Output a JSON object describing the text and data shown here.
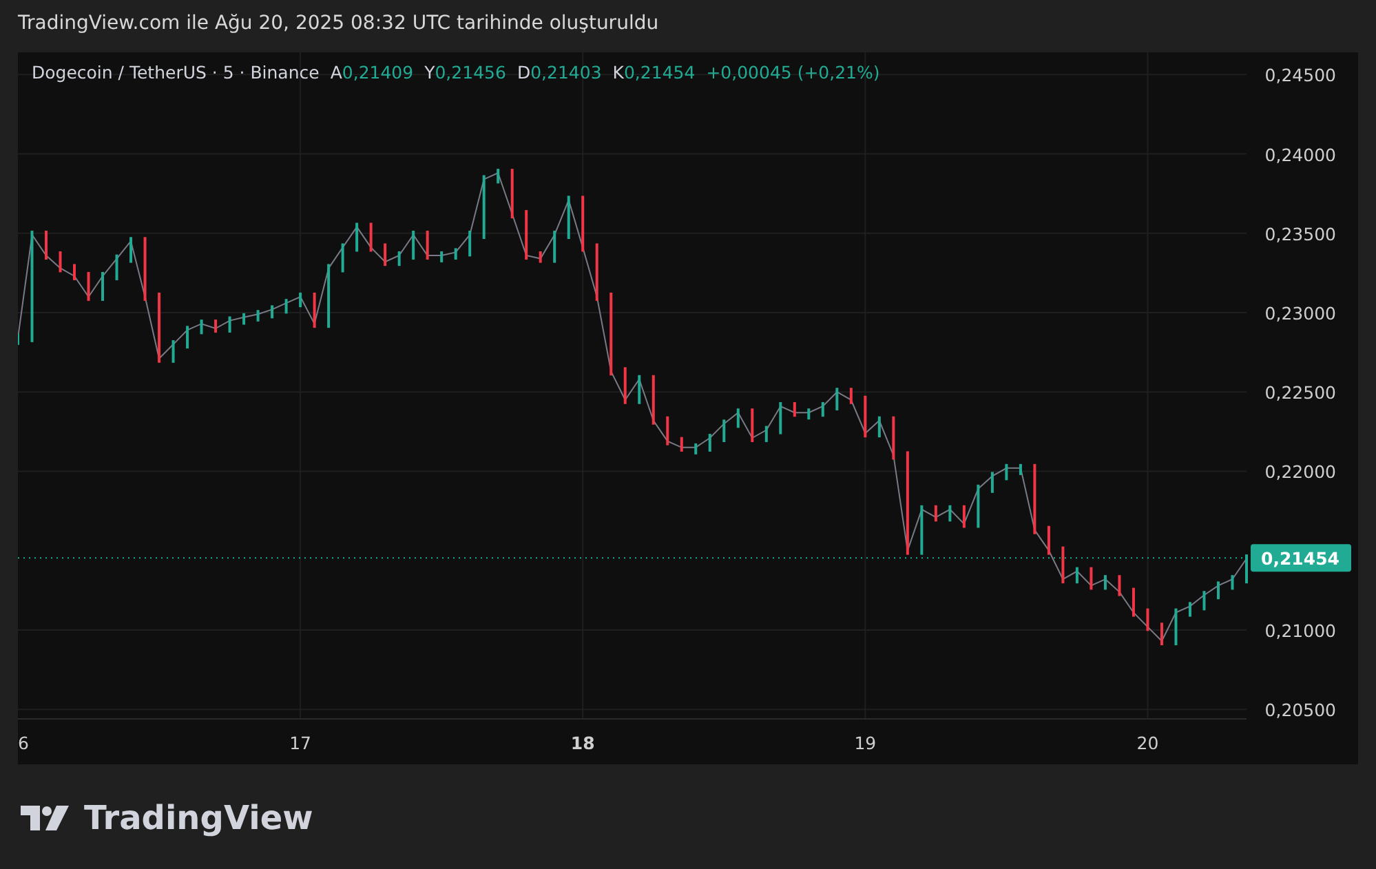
{
  "header": {
    "caption": "TradingView.com ile Ağu 20, 2025 08:32 UTC tarihinde oluşturuldu"
  },
  "legend": {
    "symbol": "Dogecoin / TetherUS · 5 · Binance",
    "ohlc": [
      {
        "label": "A",
        "value": "0,21409"
      },
      {
        "label": "Y",
        "value": "0,21456"
      },
      {
        "label": "D",
        "value": "0,21403"
      },
      {
        "label": "K",
        "value": "0,21454"
      }
    ],
    "change": "+0,00045 (+0,21%)"
  },
  "price_axis": {
    "last_price": "0,21454"
  },
  "chart": {
    "edge_date_label": "6",
    "chart_data": {
      "type": "line",
      "grid": true,
      "xlim": [
        16,
        20.35
      ],
      "ylim": [
        0.2044,
        0.2464
      ],
      "x": [
        16,
        16.05,
        16.1,
        16.15,
        16.2,
        16.25,
        16.3,
        16.35,
        16.4,
        16.45,
        16.5,
        16.55,
        16.6,
        16.65,
        16.7,
        16.75,
        16.8,
        16.85,
        16.9,
        16.95,
        17,
        17.05,
        17.1,
        17.15,
        17.2,
        17.25,
        17.3,
        17.35,
        17.4,
        17.45,
        17.5,
        17.55,
        17.6,
        17.65,
        17.7,
        17.75,
        17.8,
        17.85,
        17.9,
        17.95,
        18,
        18.05,
        18.1,
        18.15,
        18.2,
        18.25,
        18.3,
        18.35,
        18.4,
        18.45,
        18.5,
        18.55,
        18.6,
        18.65,
        18.7,
        18.75,
        18.8,
        18.85,
        18.9,
        18.95,
        19,
        19.05,
        19.1,
        19.15,
        19.2,
        19.25,
        19.3,
        19.35,
        19.4,
        19.45,
        19.5,
        19.55,
        19.6,
        19.65,
        19.7,
        19.75,
        19.8,
        19.85,
        19.9,
        19.95,
        20,
        20.05,
        20.1,
        20.15,
        20.2,
        20.25,
        20.3,
        20.35
      ],
      "xticks": [
        17,
        18,
        19,
        20
      ],
      "yticks": [
        {
          "value": 0.245,
          "label": "0,24500"
        },
        {
          "value": 0.24,
          "label": "0,24000"
        },
        {
          "value": 0.235,
          "label": "0,23500"
        },
        {
          "value": 0.23,
          "label": "0,23000"
        },
        {
          "value": 0.225,
          "label": "0,22500"
        },
        {
          "value": 0.22,
          "label": "0,22000"
        },
        {
          "value": 0.21,
          "label": "0,21000"
        },
        {
          "value": 0.205,
          "label": "0,20500"
        }
      ],
      "ref_lines": [
        {
          "axis": "y",
          "value": 0.21454
        }
      ],
      "series": [
        {
          "color": "#787b86",
          "values": [
            0.2284,
            0.2349,
            0.2336,
            0.2328,
            0.2323,
            0.231,
            0.2323,
            0.2334,
            0.2345,
            0.231,
            0.2271,
            0.228,
            0.2289,
            0.2293,
            0.229,
            0.2295,
            0.2297,
            0.2299,
            0.2302,
            0.2306,
            0.231,
            0.2293,
            0.2328,
            0.2341,
            0.2354,
            0.2341,
            0.2332,
            0.2336,
            0.2349,
            0.2336,
            0.2336,
            0.2338,
            0.2349,
            0.2384,
            0.2388,
            0.2362,
            0.2336,
            0.2334,
            0.2349,
            0.2371,
            0.2341,
            0.231,
            0.2263,
            0.2245,
            0.2258,
            0.2232,
            0.2219,
            0.2215,
            0.2215,
            0.2221,
            0.223,
            0.2237,
            0.2221,
            0.2226,
            0.2241,
            0.2237,
            0.2237,
            0.2241,
            0.225,
            0.2245,
            0.2224,
            0.2232,
            0.221,
            0.215,
            0.2176,
            0.2171,
            0.2176,
            0.2167,
            0.2189,
            0.2197,
            0.2202,
            0.2202,
            0.2163,
            0.215,
            0.2132,
            0.2137,
            0.2128,
            0.2132,
            0.2124,
            0.2111,
            0.2102,
            0.2093,
            0.2111,
            0.2115,
            0.2122,
            0.2128,
            0.2132,
            0.2145
          ]
        }
      ]
    }
  },
  "footer": {
    "brand": "TradingView"
  }
}
